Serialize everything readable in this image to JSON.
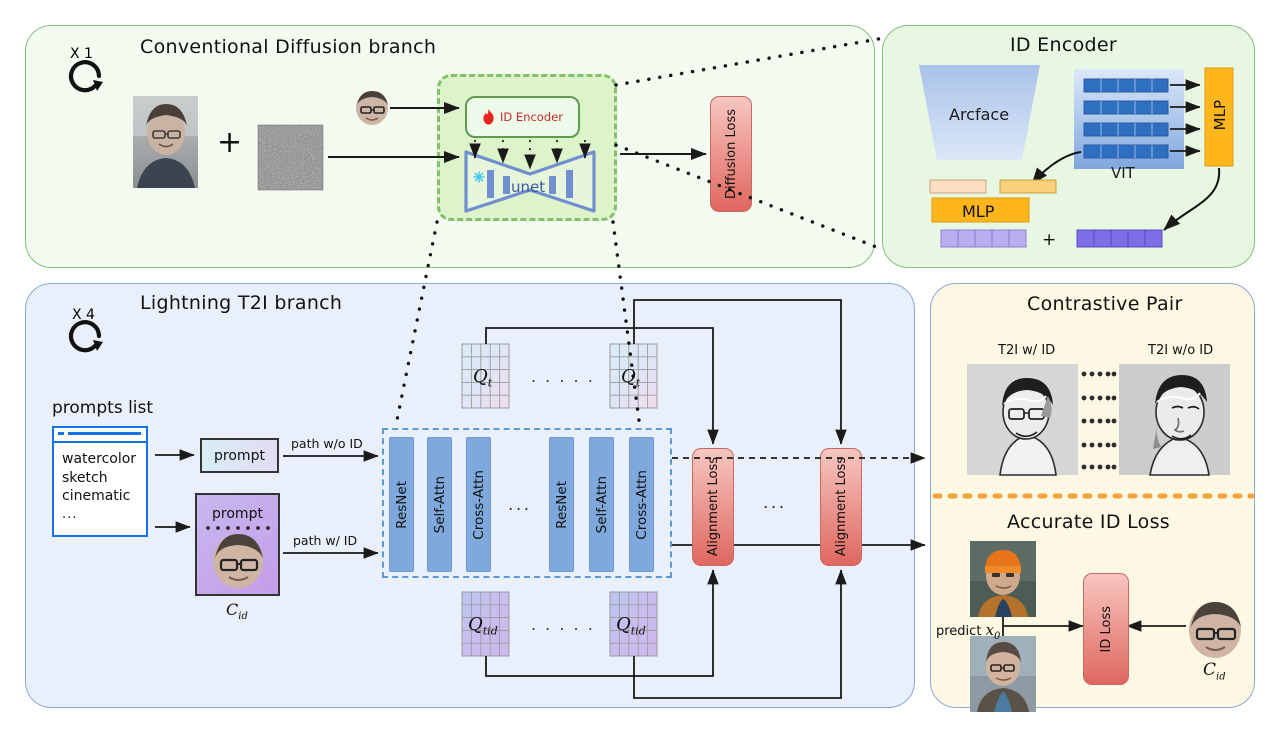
{
  "panels": {
    "diffusion": {
      "title": "Conventional Diffusion branch",
      "repeat": "X 1",
      "repeat_icon": "circular-arrow-icon"
    },
    "id_encoder": {
      "title": "ID Encoder"
    },
    "t2i": {
      "title": "Lightning T2I branch",
      "repeat": "X 4",
      "repeat_icon": "circular-arrow-icon"
    },
    "contrastive": {
      "title": "Contrastive Pair"
    },
    "accurate_id": {
      "title": "Accurate ID Loss"
    }
  },
  "diffusion": {
    "plus": "+",
    "id_encoder_box": {
      "label": "ID Encoder",
      "icon": "flame-icon"
    },
    "unet": {
      "label": "unet",
      "icon": "snowflake-icon"
    },
    "diffusion_loss": "Diffusion Loss",
    "source_image_alt": "reference-face-photo",
    "noise_alt": "gaussian-noise-patch",
    "id_face_alt": "cropped-face-thumbnail"
  },
  "id_encoder": {
    "arcface": "Arcface",
    "vit": "VIT",
    "mlp_right": "MLP",
    "mlp_left": "MLP",
    "plus": "+",
    "vit_rows": 4,
    "vit_cells_per_row": 5,
    "out_vector_cells": 5
  },
  "t2i": {
    "prompts_list_title": "prompts list",
    "prompts": [
      "watercolor",
      "sketch",
      "cinematic",
      "..."
    ],
    "prompt_plain": "prompt",
    "prompt_id": "prompt",
    "c_id": "C",
    "c_id_sub": "id",
    "path_without_id": "path w/o ID",
    "path_with_id": "path w/ ID",
    "blocks": [
      "ResNet",
      "Self-Attn",
      "Cross-Attn",
      "ResNet",
      "Self-Attn",
      "Cross-Attn"
    ],
    "blocks_ellipsis": "...",
    "q_top_left": {
      "base": "Q",
      "sub": "t"
    },
    "q_top_right": {
      "base": "Q",
      "sub": "t"
    },
    "q_bottom_left": {
      "base": "Q",
      "sub": "tid"
    },
    "q_bottom_right": {
      "base": "Q",
      "sub": "tid"
    },
    "q_ellipsis": ". . . . .",
    "alignment_loss_left": "Alignment Loss",
    "alignment_loss_right": "Alignment Loss",
    "alignment_ellipsis": "..."
  },
  "contrastive": {
    "left_label": "T2I w/ ID",
    "right_label": "T2I w/o ID",
    "left_image_alt": "sketch-portrait-with-id",
    "right_image_alt": "sketch-portrait-without-id",
    "dots_rows": 5,
    "dots_cols": 5
  },
  "accurate_id": {
    "predict_label": "predict",
    "predict_var": "x",
    "predict_sub": "0",
    "id_loss": "ID Loss",
    "c_id": "C",
    "c_id_sub": "id",
    "top_image_alt": "generated-portrait-orange-beanie",
    "bottom_image_alt": "generated-portrait-glasses",
    "ref_face_alt": "reference-face-thumbnail"
  },
  "colors": {
    "green_panel_bg": "#f3fbf0",
    "green_panel_border": "#84c07a",
    "green_panel_bg_alt": "#e7f7e2",
    "blue_panel_bg": "#eaf0fb",
    "blue_panel_border": "#8aa8d8",
    "cream_panel_bg": "#fdf8e3",
    "loss_red_top": "#f7c6c0",
    "loss_red_bottom": "#e0675f",
    "attn_blue": "#7fa8dc",
    "mlp_orange": "#ffb61c",
    "divider_orange": "#f4a23c",
    "unet_blue": "#6f8fd0",
    "dash_green": "#82c06e"
  }
}
